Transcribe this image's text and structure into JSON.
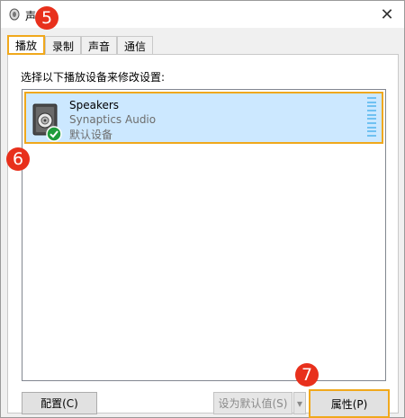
{
  "window": {
    "title": "声",
    "close_glyph": "✕"
  },
  "tabs": [
    {
      "label": "播放",
      "active": true
    },
    {
      "label": "录制",
      "active": false
    },
    {
      "label": "声音",
      "active": false
    },
    {
      "label": "通信",
      "active": false
    }
  ],
  "instruction": "选择以下播放设备来修改设置:",
  "devices": [
    {
      "name": "Speakers",
      "driver": "Synaptics Audio",
      "status": "默认设备",
      "icon": "speaker-icon",
      "status_icon": "green-check-icon"
    }
  ],
  "buttons": {
    "configure": "配置(C)",
    "set_default": "设为默认值(S)",
    "set_default_arrow": "▾",
    "properties": "属性(P)"
  },
  "callouts": [
    "5",
    "6",
    "7"
  ],
  "colors": {
    "highlight": "#f0a81c",
    "callout": "#e8301c",
    "selection": "#cce8ff"
  }
}
